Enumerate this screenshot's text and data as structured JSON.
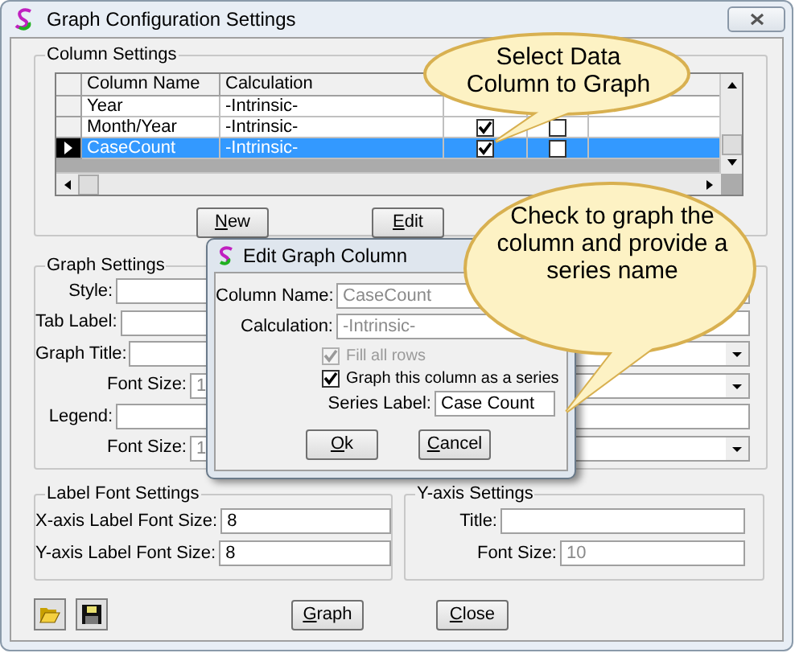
{
  "window": {
    "title": "Graph Configuration Settings"
  },
  "column_settings": {
    "title": "Column Settings",
    "columns": [
      "Column Name",
      "Calculation"
    ],
    "rows": [
      {
        "name": "Year",
        "calculation": "-Intrinsic-",
        "selected": false
      },
      {
        "name": "Month/Year",
        "calculation": "-Intrinsic-",
        "column_3": true,
        "column_4": false,
        "selected": false
      },
      {
        "name": "CaseCount",
        "calculation": "-Intrinsic-",
        "column_3": true,
        "column_4": false,
        "selected": true
      }
    ],
    "buttons": [
      "New",
      "Edit"
    ]
  },
  "graph_settings": {
    "title": "Graph Settings",
    "fields": [
      {
        "label": "Style:",
        "kind": "wide"
      },
      {
        "label": "Tab Label:",
        "kind": "wide"
      },
      {
        "label": "Graph Title:",
        "kind": "wide"
      },
      {
        "label": "Font Size:",
        "kind": "small",
        "value": "1",
        "disabled": true
      },
      {
        "label": "Legend:",
        "kind": "wide"
      },
      {
        "label": "Font Size:",
        "kind": "small",
        "value": "1",
        "disabled": true
      }
    ],
    "right_fields": [
      {
        "kind": "text"
      },
      {
        "kind": "text"
      },
      {
        "kind": "dropdown"
      },
      {
        "kind": "dropdown"
      },
      {
        "kind": "text"
      },
      {
        "kind": "dropdown"
      }
    ]
  },
  "label_font_settings": {
    "title": "Label Font Settings",
    "fields": [
      {
        "label": "X-axis Label Font Size:",
        "value": "8"
      },
      {
        "label": "Y-axis Label Font Size:",
        "value": "8"
      }
    ]
  },
  "y_axis_settings": {
    "title": "Y-axis Settings",
    "fields": [
      {
        "label": "Title:"
      },
      {
        "label": "Font Size:",
        "value": "10",
        "disabled": true
      }
    ]
  },
  "buttons": [
    "Graph",
    "Close"
  ],
  "dialog": {
    "title": "Edit Graph Column",
    "fields": [
      {
        "label": "Column Name:",
        "value": "CaseCount",
        "disabled": true
      },
      {
        "label": "Calculation:",
        "value": "-Intrinsic-",
        "disabled": true
      }
    ],
    "checks": [
      {
        "label": "Fill all rows",
        "checked": true,
        "disabled": true
      },
      {
        "label": "Graph this column as a series",
        "checked": true,
        "disabled": false
      }
    ],
    "series_label": {
      "label": "Series Label:",
      "value": "Case Count"
    },
    "buttons": [
      "Ok",
      "Cancel"
    ]
  },
  "callouts": [
    {
      "text": "Select Data Column to Graph"
    },
    {
      "text": "Check to graph the column and provide a series name"
    }
  ]
}
